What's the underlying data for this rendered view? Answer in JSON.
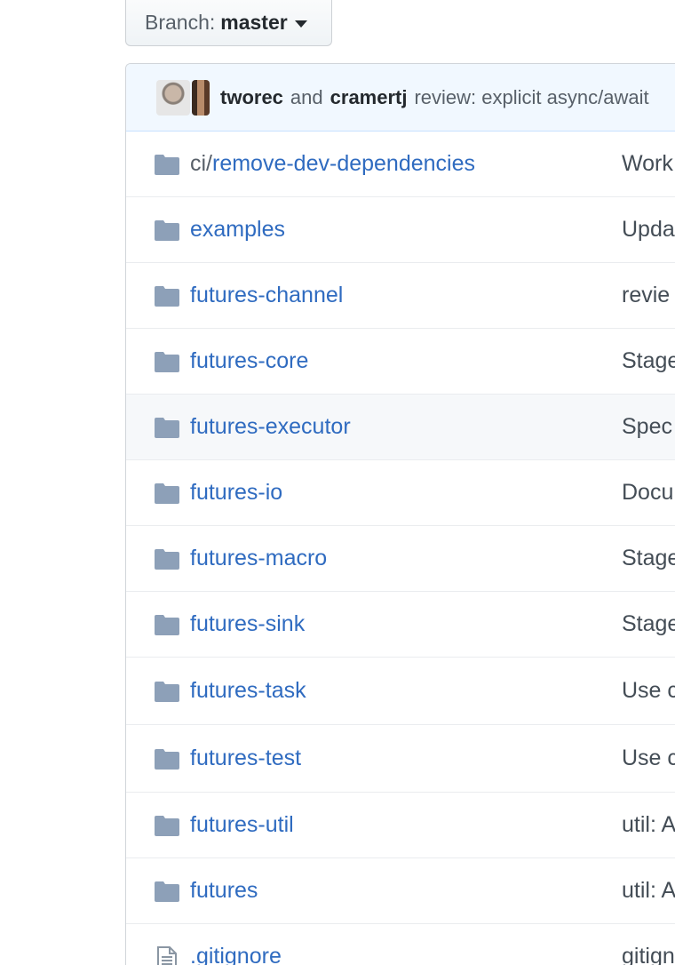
{
  "branch": {
    "prefix": "Branch:",
    "name": "master"
  },
  "commit": {
    "author1": "tworec",
    "joiner": "and",
    "author2": "cramertj",
    "message": "review: explicit async/await"
  },
  "rows": [
    {
      "type": "folder",
      "prefix": "ci/",
      "name": "remove-dev-dependencies",
      "message": "Work"
    },
    {
      "type": "folder",
      "prefix": "",
      "name": "examples",
      "message": "Upda"
    },
    {
      "type": "folder",
      "prefix": "",
      "name": "futures-channel",
      "message": "revie"
    },
    {
      "type": "folder",
      "prefix": "",
      "name": "futures-core",
      "message": "Stage"
    },
    {
      "type": "folder",
      "prefix": "",
      "name": "futures-executor",
      "message": "Spec"
    },
    {
      "type": "folder",
      "prefix": "",
      "name": "futures-io",
      "message": "Docu"
    },
    {
      "type": "folder",
      "prefix": "",
      "name": "futures-macro",
      "message": "Stage"
    },
    {
      "type": "folder",
      "prefix": "",
      "name": "futures-sink",
      "message": "Stage"
    },
    {
      "type": "folder",
      "prefix": "",
      "name": "futures-task",
      "message": "Use c"
    },
    {
      "type": "folder",
      "prefix": "",
      "name": "futures-test",
      "message": "Use c"
    },
    {
      "type": "folder",
      "prefix": "",
      "name": "futures-util",
      "message": "util: A"
    },
    {
      "type": "folder",
      "prefix": "",
      "name": "futures",
      "message": "util: A"
    },
    {
      "type": "file",
      "prefix": "",
      "name": ".gitignore",
      "message": "gitign"
    }
  ],
  "colors": {
    "link": "#2f6bc0",
    "folder_icon": "#8da0b8",
    "commit_bg": "#f1f8ff"
  }
}
